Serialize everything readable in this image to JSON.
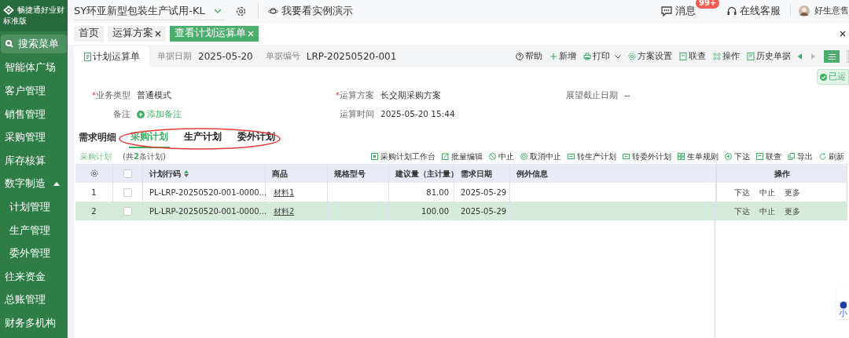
{
  "app": {
    "logo_text": "畅捷通好业财",
    "edition": "标准版"
  },
  "sidebar": {
    "search": "搜索菜单",
    "items": [
      {
        "label": "智能体广场"
      },
      {
        "label": "客户管理"
      },
      {
        "label": "销售管理"
      },
      {
        "label": "采购管理"
      },
      {
        "label": "库存核算"
      },
      {
        "label": "数字制造",
        "expanded": true,
        "children": [
          {
            "label": "计划管理"
          },
          {
            "label": "生产管理"
          },
          {
            "label": "委外管理"
          }
        ]
      },
      {
        "label": "往来资金"
      },
      {
        "label": "总账管理"
      },
      {
        "label": "财务多机构"
      }
    ]
  },
  "top_bar": {
    "company": "SY环亚新型包装生产试用-KL",
    "demo": "我要看实例演示",
    "messages": "消息",
    "badge": "99+",
    "service": "在线客服",
    "user": "好生意售"
  },
  "tabs": [
    {
      "label": "首页",
      "closable": false,
      "selected": false
    },
    {
      "label": "运算方案",
      "closable": true,
      "selected": false
    },
    {
      "label": "查看计划运算单",
      "closable": true,
      "selected": true
    }
  ],
  "document": {
    "tab": "计划运算单",
    "date_label": "单据日期",
    "date": "2025-05-20",
    "number_label": "单据编号",
    "number": "LRP-20250520-001",
    "actions": [
      {
        "label": "帮助"
      },
      {
        "label": "新增"
      },
      {
        "label": "打印",
        "dropdown": true
      },
      {
        "label": "方案设置"
      },
      {
        "label": "联查"
      },
      {
        "label": "操作"
      },
      {
        "label": "历史单据"
      }
    ],
    "status": "已运"
  },
  "form": [
    {
      "label": "业务类型",
      "required_mark": "*",
      "value": "普通模式"
    },
    {
      "label": "运算方案",
      "required_mark": "*",
      "value": "长交期采购方案"
    },
    {
      "label": "展望截止日期",
      "value": "--"
    },
    {
      "label": "备注",
      "link": "添加备注"
    },
    {
      "label": "运算时间",
      "value": "2025-05-20 15:44"
    }
  ],
  "section_label": "需求明细",
  "section_tabs": [
    {
      "label": "采购计划",
      "selected": true
    },
    {
      "label": "生产计划",
      "selected": false
    },
    {
      "label": "委外计划",
      "selected": false
    }
  ],
  "list_title": "采购计划",
  "list_count": "(共**2**条计划)",
  "table_actions": [
    "采购计划工作台",
    "批量编辑",
    "中止",
    "取消中止",
    "转生产计划",
    "转委外计划",
    "生单规则",
    "下达",
    "联查",
    "导出",
    "刷新"
  ],
  "table": {
    "select_all_checked": false,
    "columns": [
      "计划行码",
      "商品",
      "规格型号",
      "建议量（主计量）",
      "需求日期",
      "例外信息",
      "操作"
    ],
    "rows": [
      {
        "selected": false,
        "checked": false,
        "index": "1",
        "code": "PL-LRP-20250520-001-0000...",
        "product": "材料1",
        "quantity": "81.00",
        "date": "2025-05-29",
        "actions": [
          "下达",
          "中止",
          "更多"
        ]
      },
      {
        "selected": true,
        "checked": false,
        "index": "2",
        "code": "PL-LRP-20250520-001-0000...",
        "product": "材料2",
        "quantity": "100.00",
        "date": "2025-05-29",
        "actions": [
          "下达",
          "中止",
          "更多"
        ]
      }
    ]
  },
  "widget": {
    "label": "小"
  }
}
